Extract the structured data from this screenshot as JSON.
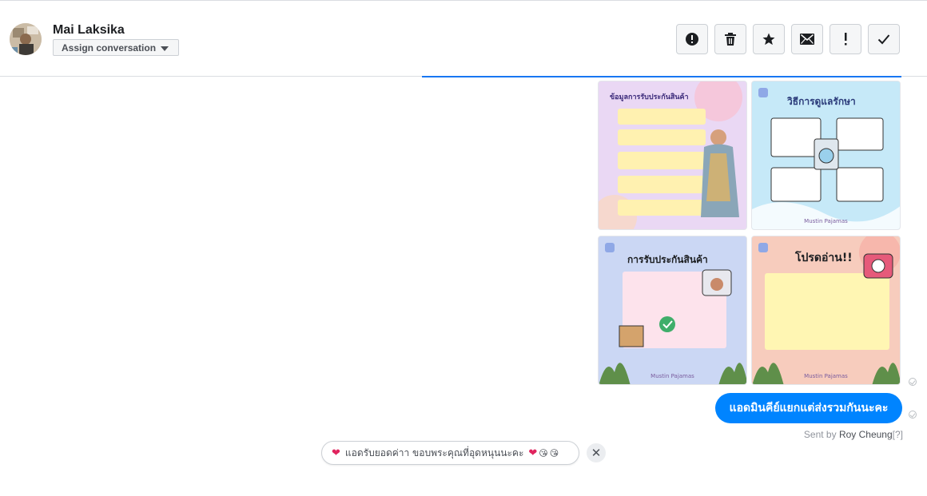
{
  "header": {
    "contact_name": "Mai Laksika",
    "assign_label": "Assign conversation",
    "actions": [
      {
        "name": "spam-button",
        "icon": "alert-circle-icon"
      },
      {
        "name": "delete-button",
        "icon": "trash-icon"
      },
      {
        "name": "star-button",
        "icon": "star-icon"
      },
      {
        "name": "mark-unread-button",
        "icon": "envelope-icon"
      },
      {
        "name": "follow-up-button",
        "icon": "exclamation-icon"
      },
      {
        "name": "mark-done-button",
        "icon": "checkmark-icon"
      }
    ]
  },
  "images": [
    {
      "title": "ข้อมูลการรับประกันสินค้า",
      "footer": ""
    },
    {
      "title": "วิธีการดูแลรักษา",
      "footer": "Mustin Pajamas"
    },
    {
      "title": "การรับประกันสินค้า",
      "footer": "Mustin Pajamas"
    },
    {
      "title": "โปรดอ่าน!!",
      "footer": "Mustin Pajamas"
    }
  ],
  "message": {
    "text": "แอดมินคีย์แยกแต่ส่งรวมกันนะคะ",
    "sent_by_prefix": "Sent by",
    "sent_by_name": "Roy Cheung",
    "sent_by_suffix": "[?]"
  },
  "quick_reply": {
    "text": "แอดรับยอดค่าา ขอบพระคุณที่อุดหนุนนะคะ",
    "close_symbol": "✕"
  },
  "colors": {
    "accent": "#0084ff",
    "border": "#ccd0d5"
  }
}
